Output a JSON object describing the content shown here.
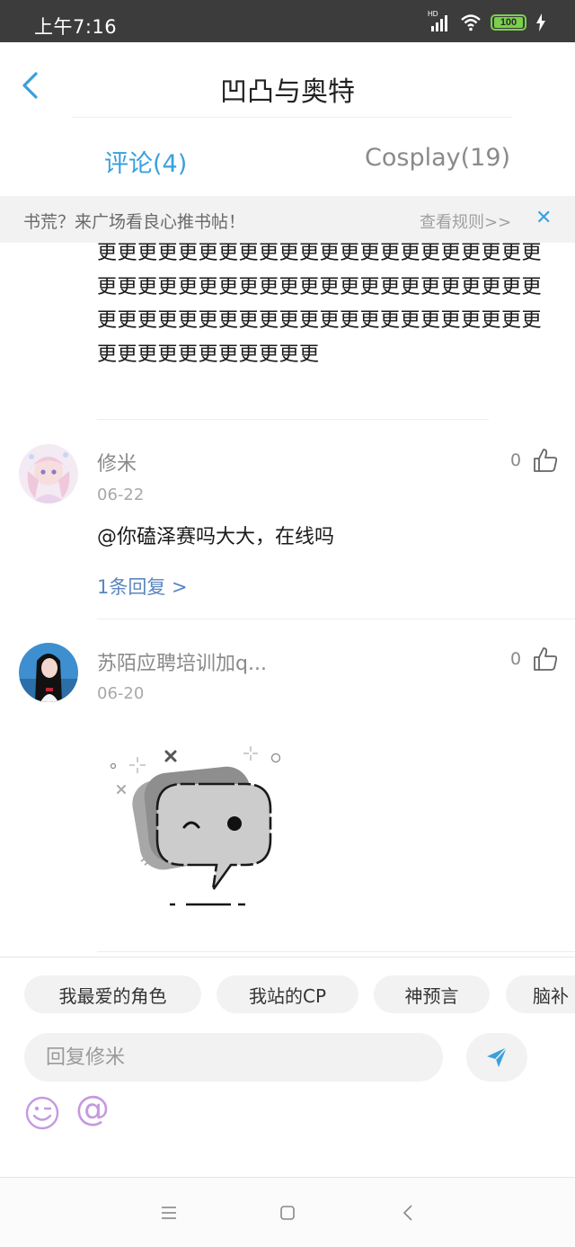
{
  "status_bar": {
    "time": "上午7:16",
    "battery": "100",
    "network": "HD"
  },
  "nav": {
    "title": "凹凸与奥特"
  },
  "tabs": [
    {
      "label": "评论(4)",
      "active": true
    },
    {
      "label": "Cosplay(19)",
      "active": false
    }
  ],
  "notice": {
    "text": "书荒？来广场看良心推书帖！",
    "link": "查看规则>>",
    "close": "✕"
  },
  "previous_comment": {
    "text": "更更更更更更更更更更更更更更更更更更更更更更更更更更更更更更更更更更更更更更更更更更更更更更更更更更更更更更更更更更更更更更更更更更更更更更更更更更更更更"
  },
  "comments": [
    {
      "name": "修米",
      "date": "06-22",
      "text": "@你磕泽赛吗大大，在线吗",
      "reply_link": "1条回复 >",
      "likes": "0"
    },
    {
      "name": "苏陌应聘培训加q...",
      "date": "06-20",
      "likes": "0"
    }
  ],
  "quick_tags": [
    "我最爱的角色",
    "我站的CP",
    "神预言",
    "脑补"
  ],
  "reply": {
    "placeholder": "回复修米"
  },
  "at_symbol": "@",
  "colors": {
    "accent": "#3aa0dc",
    "link": "#5a86c0",
    "at": "#c49ae0"
  }
}
